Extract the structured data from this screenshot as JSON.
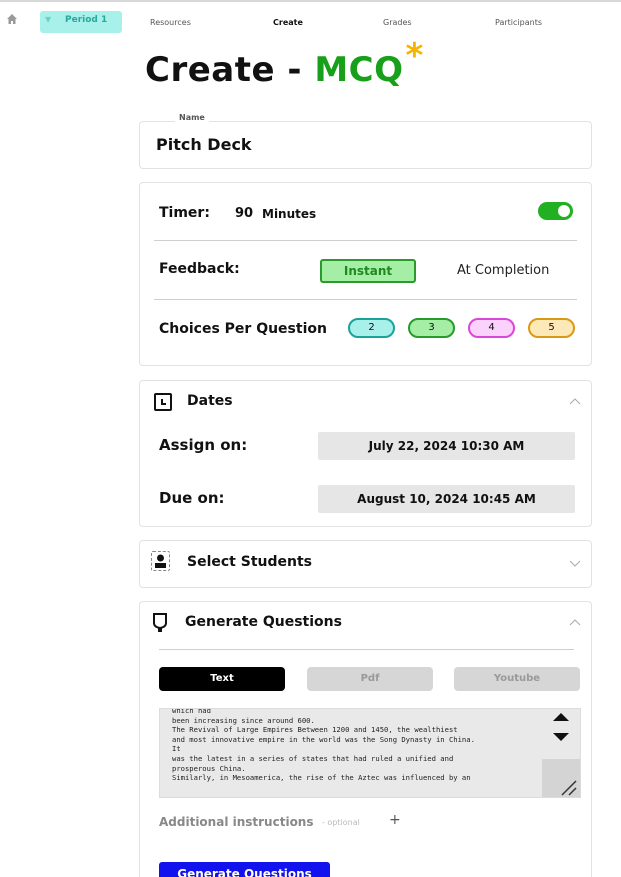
{
  "nav": {
    "period_label": "Period 1",
    "links": [
      "Resources",
      "Create",
      "Grades",
      "Participants"
    ],
    "active_link": "Create"
  },
  "page": {
    "title_prefix": "Create -",
    "title_accent": "MCQ",
    "title_star": "*",
    "accent_color": "#19a01a",
    "star_color": "#f5b400"
  },
  "name_card": {
    "label": "Name",
    "value": "Pitch Deck"
  },
  "settings": {
    "timer_label": "Timer:",
    "timer_value": "90",
    "timer_unit": "Minutes",
    "timer_enabled": true,
    "feedback_label": "Feedback:",
    "feedback_options": [
      "Instant",
      "At Completion"
    ],
    "feedback_selected": "Instant",
    "choices_label": "Choices Per Question",
    "choices": [
      {
        "label": "2",
        "border": "#1aa39a",
        "bg": "#a8f0ea"
      },
      {
        "label": "3",
        "border": "#2a9a2a",
        "bg": "#a5eea5"
      },
      {
        "label": "4",
        "border": "#d946d9",
        "bg": "#fbd2fb"
      },
      {
        "label": "5",
        "border": "#d89a16",
        "bg": "#fde8b8"
      }
    ]
  },
  "dates": {
    "title": "Dates",
    "assign_label": "Assign on:",
    "assign_value": "July 22, 2024 10:30 AM",
    "due_label": "Due on:",
    "due_value": "August 10, 2024 10:45 AM"
  },
  "students": {
    "title": "Select Students"
  },
  "generate": {
    "title": "Generate Questions",
    "tabs": [
      "Text",
      "Pdf",
      "Youtube"
    ],
    "active_tab": "Text",
    "text_content": "which had\nbeen increasing since around 600.\nThe Revival of Large Empires Between 1200 and 1450, the wealthiest\nand most innovative empire in the world was the Song Dynasty in China.\nIt\nwas the latest in a series of states that had ruled a unified and\nprosperous China.\nSimilarly, in Mesoamerica, the rise of the Aztec was influenced by an",
    "additional_label": "Additional instructions",
    "optional_label": "- optional",
    "plus_label": "+",
    "button_label": "Generate Questions"
  }
}
